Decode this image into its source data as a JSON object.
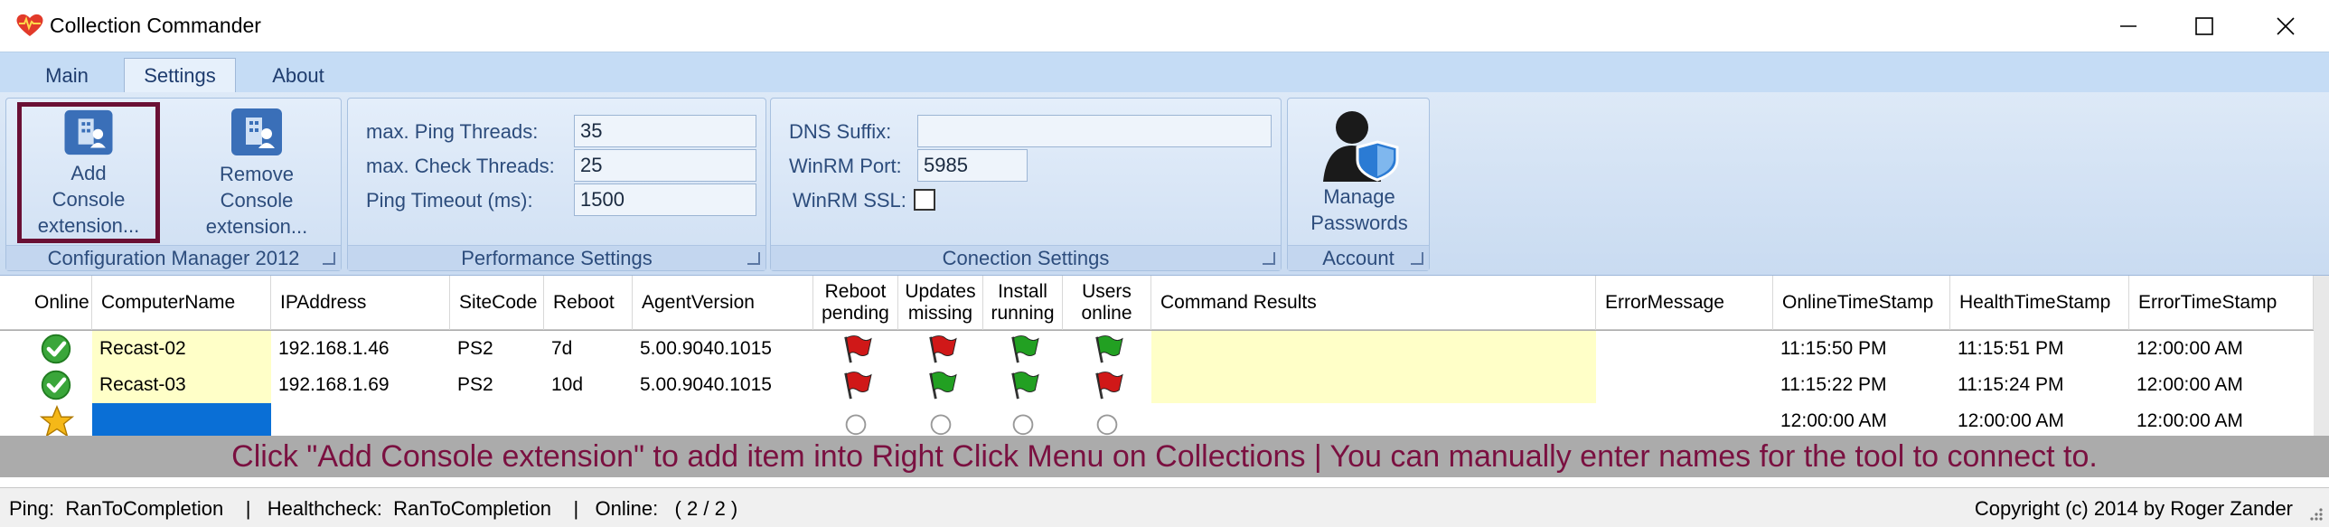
{
  "window": {
    "title": "Collection Commander"
  },
  "tabs": [
    {
      "label": "Main"
    },
    {
      "label": "Settings"
    },
    {
      "label": "About"
    }
  ],
  "ribbon": {
    "groups": {
      "configmgr": {
        "label": "Configuration Manager 2012",
        "add_button": {
          "line1": "Add",
          "line2": "Console",
          "line3": "extension..."
        },
        "remove_button": {
          "line1": "Remove",
          "line2": "Console",
          "line3": "extension..."
        }
      },
      "performance": {
        "label": "Performance Settings",
        "ping_threads_label": "max. Ping Threads:",
        "ping_threads_value": "35",
        "check_threads_label": "max. Check Threads:",
        "check_threads_value": "25",
        "ping_timeout_label": "Ping Timeout (ms):",
        "ping_timeout_value": "1500"
      },
      "connection": {
        "label": "Conection Settings",
        "dns_suffix_label": "DNS Suffix:",
        "dns_suffix_value": "",
        "winrm_port_label": "WinRM Port:",
        "winrm_port_value": "5985",
        "winrm_ssl_label": "WinRM SSL:",
        "winrm_ssl_checked": false
      },
      "account": {
        "label": "Account",
        "manage_button": {
          "line1": "Manage",
          "line2": "Passwords"
        }
      }
    }
  },
  "grid": {
    "columns": [
      {
        "label": "Online"
      },
      {
        "label": "ComputerName"
      },
      {
        "label": "IPAddress"
      },
      {
        "label": "SiteCode"
      },
      {
        "label": "Reboot"
      },
      {
        "label": "AgentVersion"
      },
      {
        "label": "Reboot pending"
      },
      {
        "label": "Updates missing"
      },
      {
        "label": "Install running"
      },
      {
        "label": "Users online"
      },
      {
        "label": "Command Results"
      },
      {
        "label": "ErrorMessage"
      },
      {
        "label": "OnlineTimeStamp"
      },
      {
        "label": "HealthTimeStamp"
      },
      {
        "label": "ErrorTimeStamp"
      }
    ],
    "rows": [
      {
        "status_icon": "green-check-icon",
        "computer_name": "Recast-02",
        "ip": "192.168.1.46",
        "site_code": "PS2",
        "reboot": "7d",
        "agent_version": "5.00.9040.1015",
        "flags": [
          "red",
          "red",
          "green",
          "green"
        ],
        "command_results": "",
        "error_message": "",
        "online_ts": "11:15:50 PM",
        "health_ts": "11:15:51 PM",
        "error_ts": "12:00:00 AM"
      },
      {
        "status_icon": "green-check-icon",
        "computer_name": "Recast-03",
        "ip": "192.168.1.69",
        "site_code": "PS2",
        "reboot": "10d",
        "agent_version": "5.00.9040.1015",
        "flags": [
          "red",
          "green",
          "green",
          "red"
        ],
        "command_results": "",
        "error_message": "",
        "online_ts": "11:15:22 PM",
        "health_ts": "11:15:24 PM",
        "error_ts": "12:00:00 AM"
      },
      {
        "status_icon": "star-icon",
        "computer_name": "",
        "ip": "",
        "site_code": "",
        "reboot": "",
        "agent_version": "",
        "flags": [
          "empty",
          "empty",
          "empty",
          "empty"
        ],
        "command_results": "",
        "error_message": "",
        "online_ts": "12:00:00 AM",
        "health_ts": "12:00:00 AM",
        "error_ts": "12:00:00 AM"
      }
    ],
    "hint": "Click \"Add Console extension\" to add item into Right Click Menu on Collections | You can manually enter names for the tool to connect to."
  },
  "statusbar": {
    "left": "Ping:  RanToCompletion    |   Healthcheck:  RanToCompletion    |   Online:   ( 2 / 2 )",
    "right": "Copyright (c) 2014 by Roger Zander"
  },
  "colors": {
    "flag_red": "#d01818",
    "flag_green": "#22a022",
    "highlight_border": "#6a1035",
    "hint_text": "#7a1040",
    "new_row_blue": "#0a6fd6"
  }
}
